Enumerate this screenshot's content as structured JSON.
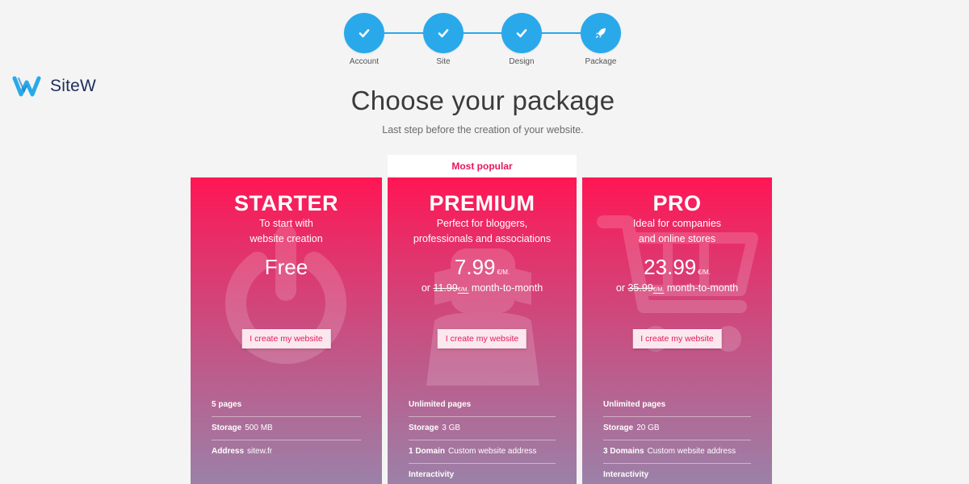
{
  "brand": {
    "name": "SiteW",
    "colors": {
      "accent": "#29a9ea",
      "pink": "#e5175c",
      "logo_dark": "#1c2e5a"
    }
  },
  "stepper": {
    "steps": [
      {
        "label": "Account",
        "icon": "check-icon",
        "state": "completed"
      },
      {
        "label": "Site",
        "icon": "check-icon",
        "state": "completed"
      },
      {
        "label": "Design",
        "icon": "check-icon",
        "state": "completed"
      },
      {
        "label": "Package",
        "icon": "rocket-icon",
        "state": "current"
      }
    ]
  },
  "header": {
    "title": "Choose your package",
    "subtitle": "Last step before the creation of your website."
  },
  "popular_label": "Most popular",
  "plans": [
    {
      "name": "STARTER",
      "desc_lines": [
        "To start with",
        "website creation"
      ],
      "price": "Free",
      "cta": "I create my website",
      "background_icon": "power-icon",
      "features": [
        {
          "bold": "5 pages",
          "text": ""
        },
        {
          "bold": "Storage",
          "text": "500 MB"
        },
        {
          "bold": "Address",
          "text": "sitew.fr"
        }
      ]
    },
    {
      "name": "PREMIUM",
      "desc_lines": [
        "Perfect for bloggers,",
        "professionals and associations"
      ],
      "price": "7.99",
      "unit": "€/M.",
      "old_prefix": "or",
      "old_price": "11.99",
      "old_unit": "€/M.",
      "old_suffix": "month-to-month",
      "cta": "I create my website",
      "background_icon": "person-icon",
      "features": [
        {
          "bold": "Unlimited pages",
          "text": ""
        },
        {
          "bold": "Storage",
          "text": "3 GB"
        },
        {
          "bold": "1 Domain",
          "text": "Custom website address"
        },
        {
          "bold": "Interactivity",
          "text": ""
        }
      ]
    },
    {
      "name": "PRO",
      "desc_lines": [
        "Ideal for companies",
        "and online stores"
      ],
      "price": "23.99",
      "unit": "€/M.",
      "old_prefix": "or",
      "old_price": "35.99",
      "old_unit": "€/M.",
      "old_suffix": "month-to-month",
      "cta": "I create my website",
      "background_icon": "shopping-cart-icon",
      "features": [
        {
          "bold": "Unlimited pages",
          "text": ""
        },
        {
          "bold": "Storage",
          "text": "20 GB"
        },
        {
          "bold": "3 Domains",
          "text": "Custom website address"
        },
        {
          "bold": "Interactivity",
          "text": ""
        }
      ]
    }
  ]
}
